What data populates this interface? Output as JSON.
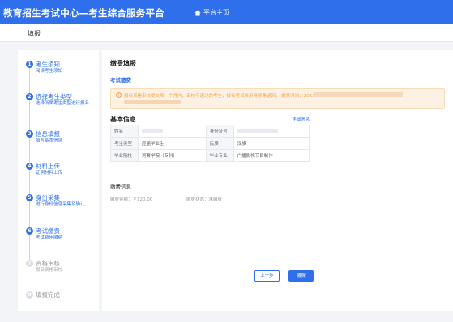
{
  "header": {
    "brand": "教育招生考试中心—考生综合服务平台",
    "home": "平台主页"
  },
  "subbar": {
    "title": "填报"
  },
  "steps": [
    {
      "num": "1",
      "title": "考生须知",
      "desc": "阅读考生须知",
      "active": true
    },
    {
      "num": "2",
      "title": "选择考生类型",
      "desc": "选择所属考生类型进行报名",
      "active": true
    },
    {
      "num": "3",
      "title": "信息填报",
      "desc": "填写基本信息",
      "active": true
    },
    {
      "num": "4",
      "title": "材料上传",
      "desc": "证明材料上传",
      "active": true
    },
    {
      "num": "5",
      "title": "身份采集",
      "desc": "进行身份信息采集及确认",
      "active": true
    },
    {
      "num": "6",
      "title": "考试缴费",
      "desc": "考试费用缴纳",
      "active": true
    },
    {
      "num": "7",
      "title": "资格审核",
      "desc": "报名资格审核",
      "active": false
    },
    {
      "num": "8",
      "title": "填报完成",
      "desc": "",
      "active": false
    }
  ],
  "main": {
    "title": "缴费填报",
    "section": "考试缴费",
    "warning": "报名资格审核提交后一个月内，审核不通过的考生，报名考试费用将原路返回。 缴费时间：2021",
    "basic_title": "基本信息",
    "more_link": "详细信息",
    "table": {
      "r1": {
        "k1": "姓名",
        "k2": "身份证号"
      },
      "r2": {
        "k1": "考生类型",
        "v1": "应届毕业生",
        "k2": "民族",
        "v2": "汉族"
      },
      "r3": {
        "k1": "毕业院校",
        "v1": "河套学院（专科）",
        "k2": "毕业专业",
        "v2": "广播影视节目制作"
      }
    },
    "pay_title": "缴费信息",
    "pay_amount": "缴费金额：￥120.00",
    "pay_status": "缴费状态：未缴费",
    "btn_prev": "上一步",
    "btn_pay": "缴费"
  },
  "colors": {
    "primary": "#2f6fec",
    "warning": "#f0a54a"
  }
}
